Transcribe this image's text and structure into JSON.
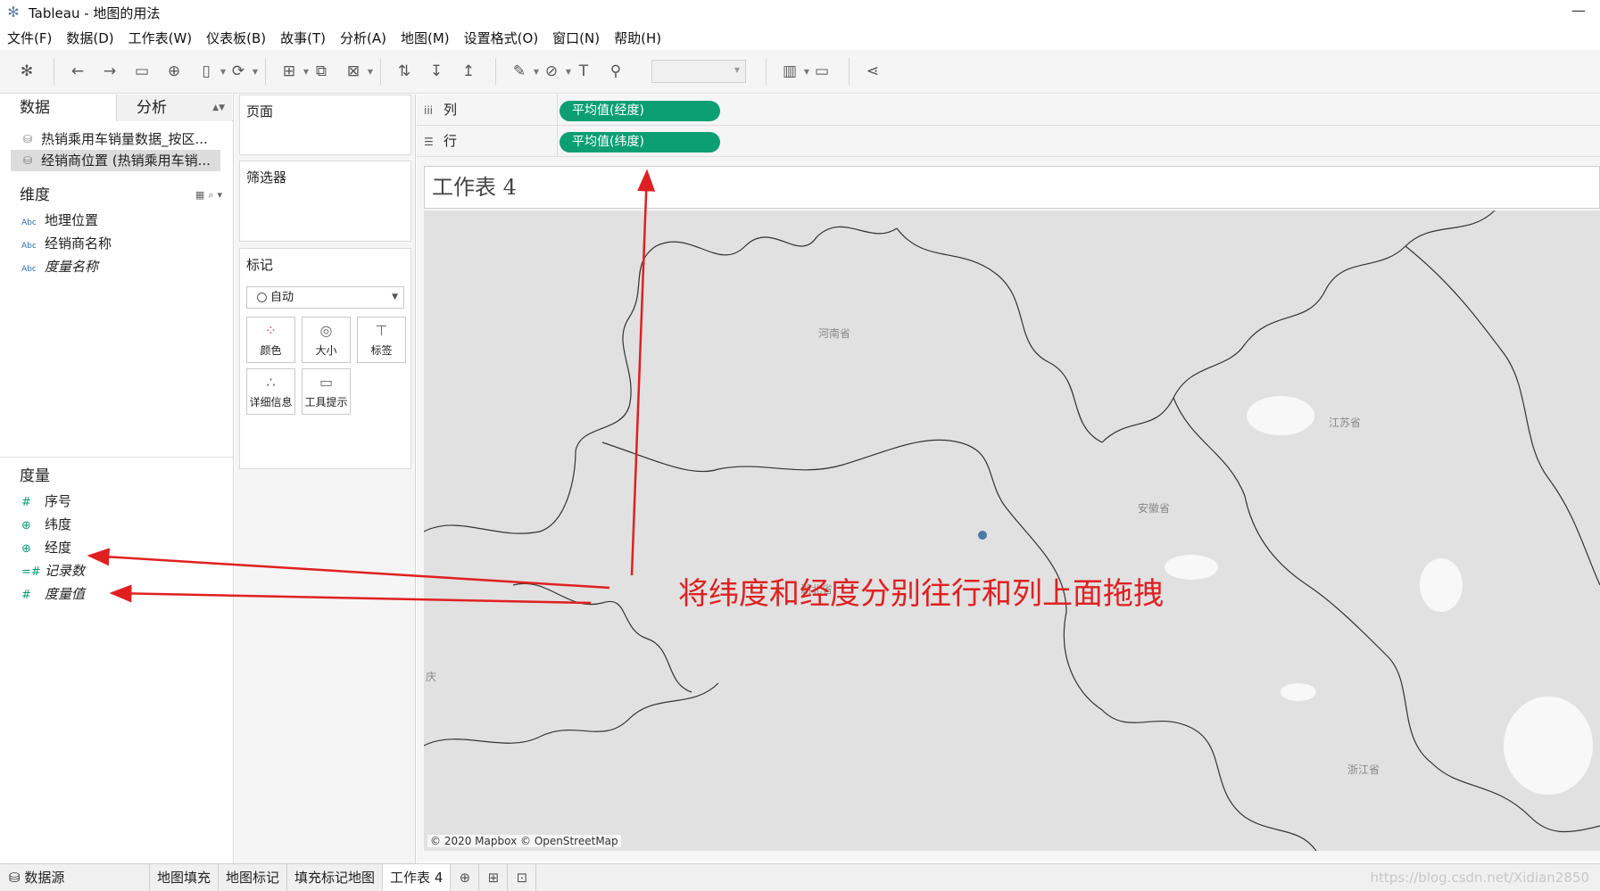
{
  "window": {
    "title": "Tableau - 地图的用法",
    "minimize_glyph": "—"
  },
  "menu": [
    "文件(F)",
    "数据(D)",
    "工作表(W)",
    "仪表板(B)",
    "故事(T)",
    "分析(A)",
    "地图(M)",
    "设置格式(O)",
    "窗口(N)",
    "帮助(H)"
  ],
  "toolbar": {
    "icons": [
      "tableau-logo-icon",
      "undo-icon",
      "redo-icon",
      "save-icon",
      "new-datasource-icon",
      "pause-updates-icon",
      "refresh-icon",
      "new-worksheet-icon",
      "duplicate-sheet-icon",
      "clear-sheet-icon",
      "swap-rows-columns-icon",
      "sort-ascending-icon",
      "sort-descending-icon",
      "highlight-icon",
      "group-icon",
      "label-icon",
      "pin-icon",
      "show-me-icon",
      "presentation-icon",
      "share-icon"
    ]
  },
  "data_pane": {
    "tab_data": "数据",
    "tab_analysis": "分析",
    "datasources": [
      "热销乘用车销量数据_按区...",
      "经销商位置 (热销乘用车销..."
    ],
    "dimensions_title": "维度",
    "dimensions": [
      {
        "type": "Abc",
        "name": "地理位置",
        "italic": false
      },
      {
        "type": "Abc",
        "name": "经销商名称",
        "italic": false
      },
      {
        "type": "Abc",
        "name": "度量名称",
        "italic": true
      }
    ],
    "measures_title": "度量",
    "measures": [
      {
        "type": "#",
        "name": "序号",
        "italic": false
      },
      {
        "type": "⊕",
        "name": "纬度",
        "italic": false
      },
      {
        "type": "⊕",
        "name": "经度",
        "italic": false
      },
      {
        "type": "=#",
        "name": "记录数",
        "italic": true
      },
      {
        "type": "#",
        "name": "度量值",
        "italic": true
      }
    ]
  },
  "cards": {
    "pages_title": "页面",
    "filters_title": "筛选器",
    "marks_title": "标记",
    "marks_type": "自动",
    "mark_buttons": [
      "颜色",
      "大小",
      "标签",
      "详细信息",
      "工具提示"
    ]
  },
  "shelves": {
    "columns_label": "列",
    "columns_pill": "平均值(经度)",
    "rows_label": "行",
    "rows_pill": "平均值(纬度)"
  },
  "worksheet": {
    "title": "工作表 4",
    "attribution": "© 2020 Mapbox © OpenStreetMap",
    "province_labels": [
      "河南省",
      "江苏省",
      "安徽省",
      "湖北省",
      "浙江省",
      "庆"
    ],
    "annotation": "将纬度和经度分别往行和列上面拖拽"
  },
  "tabs": {
    "datasource": "数据源",
    "sheets": [
      "地图填充",
      "地图标记",
      "填充标记地图",
      "工作表 4"
    ],
    "active_sheet": "工作表 4",
    "watermark": "https://blog.csdn.net/Xidian2850"
  },
  "colors": {
    "pill_green": "#0c9f74",
    "annotation_red": "#e02020",
    "map_gray": "#e1e1e1",
    "mark_blue": "#4e79a7"
  }
}
